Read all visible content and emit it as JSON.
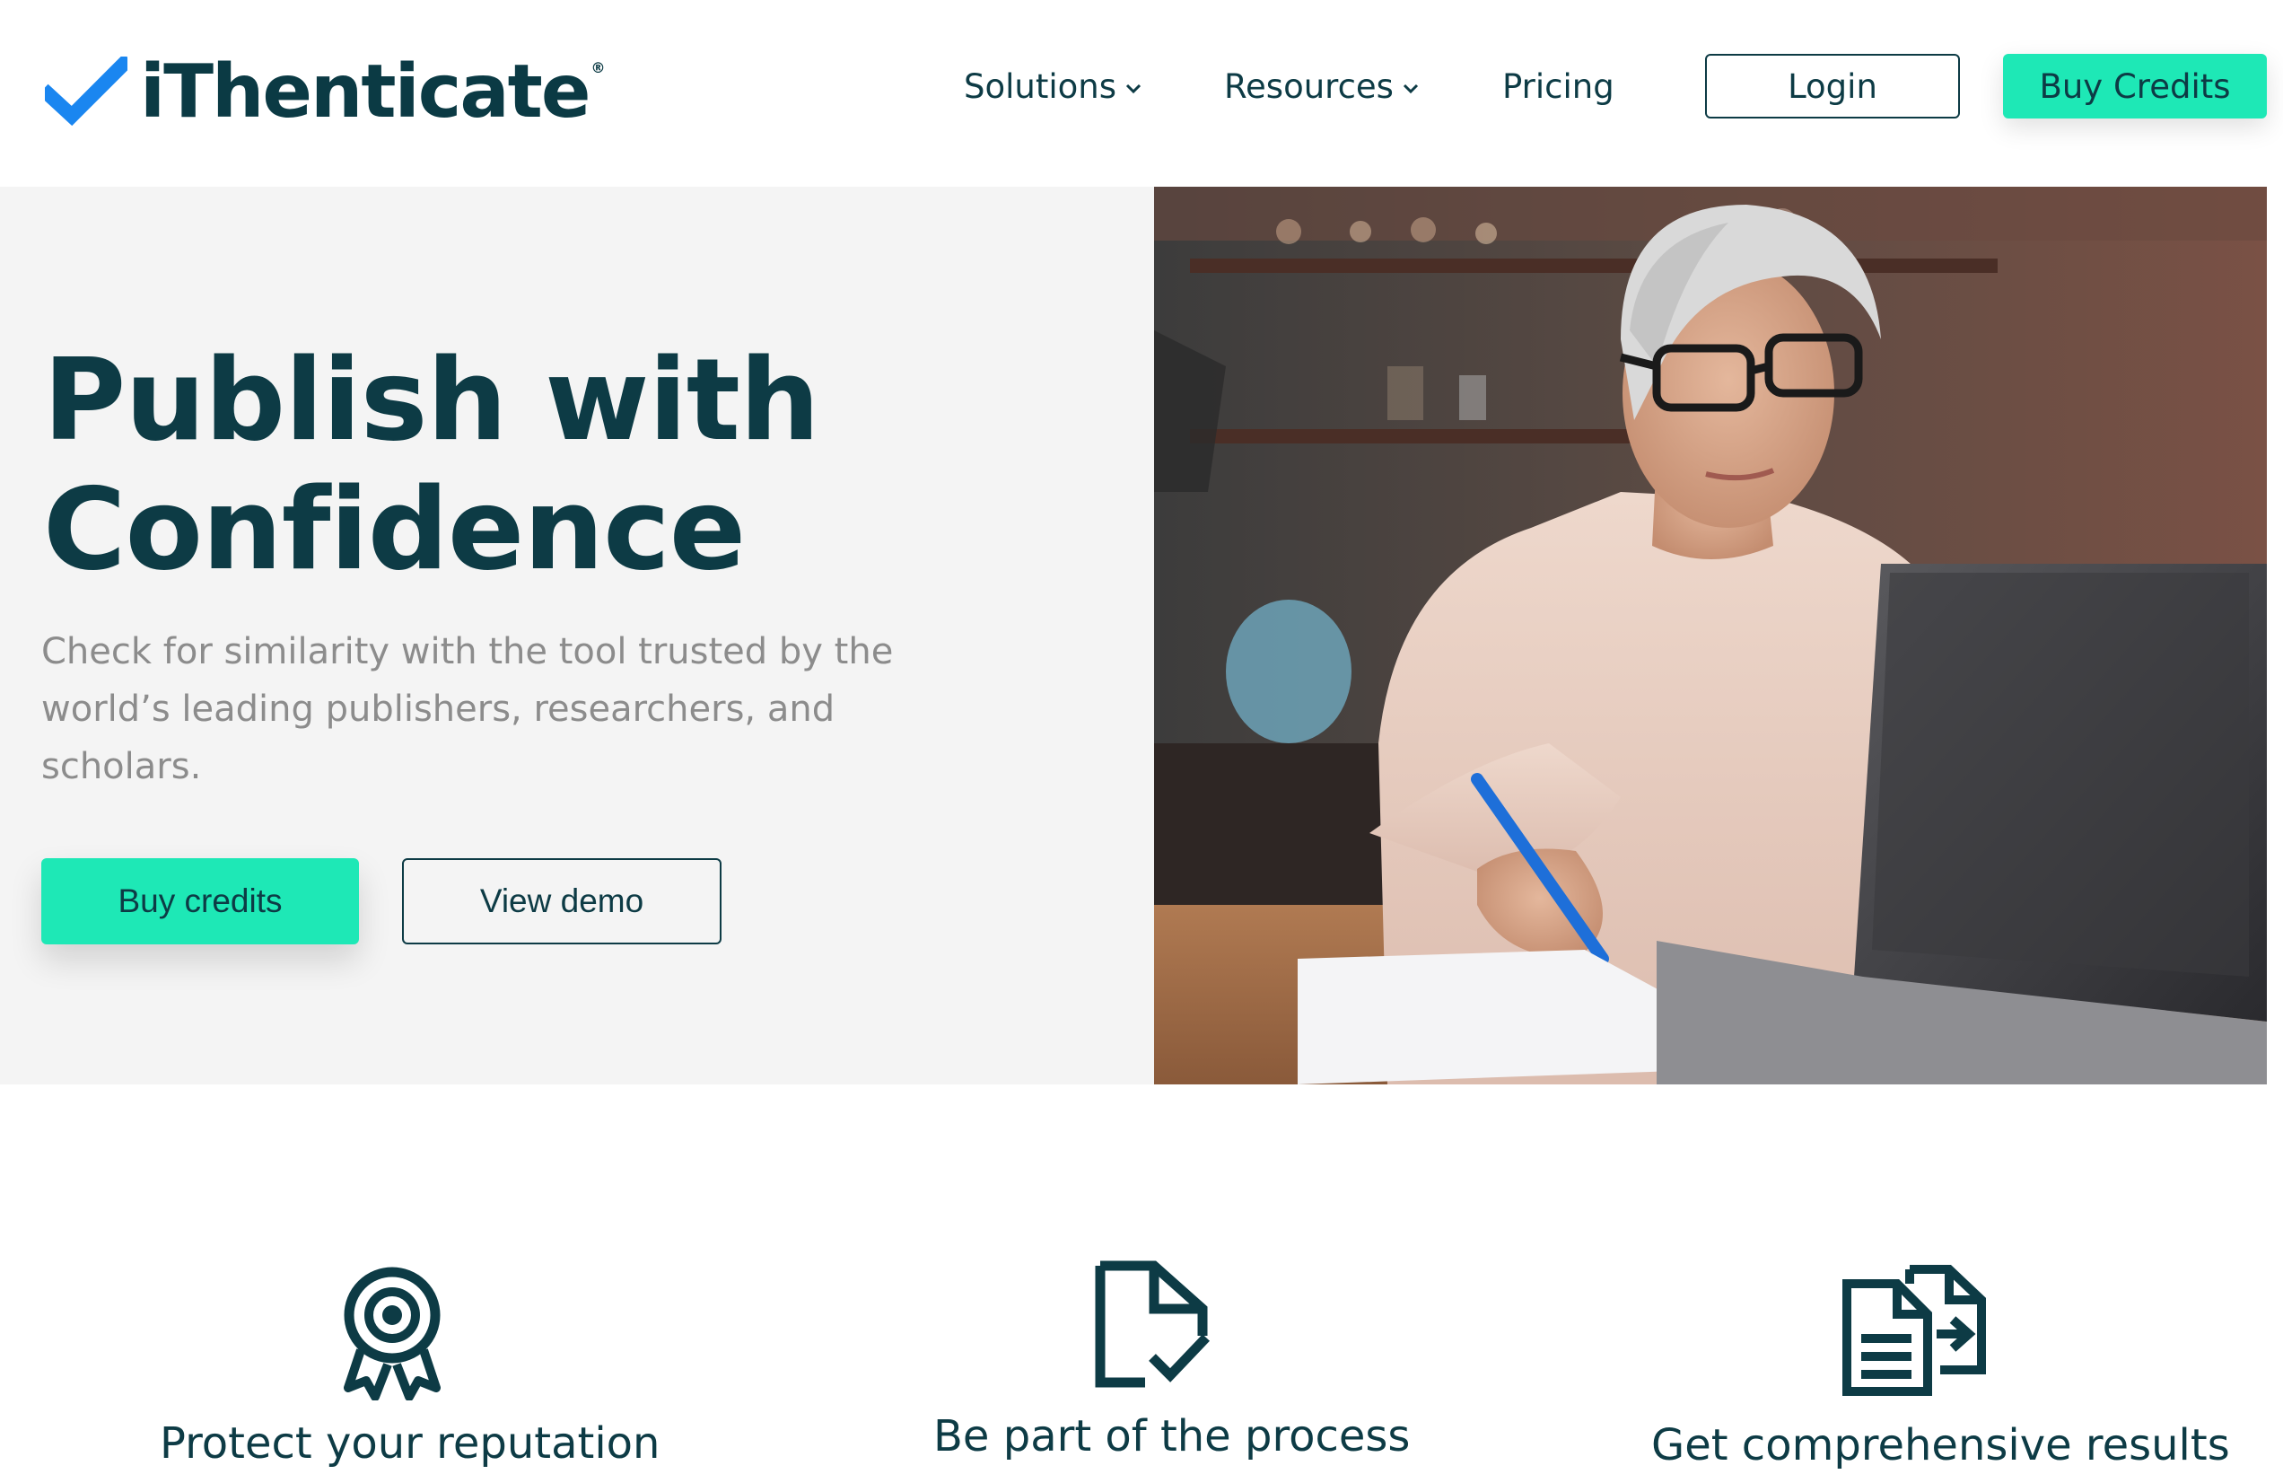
{
  "header": {
    "logo": {
      "text": "iThenticate",
      "reg": "®",
      "check_icon": "checkmark-icon"
    },
    "nav": {
      "solutions": "Solutions",
      "resources": "Resources",
      "pricing": "Pricing"
    },
    "login_label": "Login",
    "buy_credits_label": "Buy Credits"
  },
  "hero": {
    "title_line1": "Publish with",
    "title_line2": "Confidence",
    "subtitle": "Check for similarity with the tool trusted by the world’s leading publishers, researchers, and scholars.",
    "buy_credits_label": "Buy credits",
    "view_demo_label": "View demo",
    "photo_icon": "photo-woman-with-laptop"
  },
  "features": [
    {
      "label": "Protect your reputation",
      "icon": "award-ribbon-icon"
    },
    {
      "label": "Be part of the process",
      "icon": "document-check-icon"
    },
    {
      "label": "Get comprehensive results",
      "icon": "document-compare-icon"
    }
  ],
  "colors": {
    "brand_dark": "#0d3b45",
    "accent_green": "#1ee8b6",
    "check_blue": "#1a86f0",
    "hero_bg": "#f4f4f4",
    "subtitle_gray": "#8c8c8c"
  }
}
